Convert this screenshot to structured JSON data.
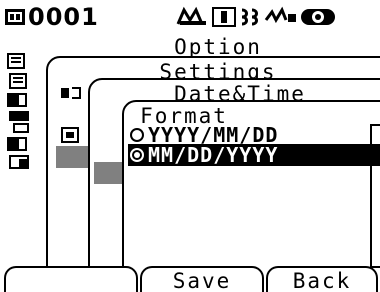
{
  "status": {
    "counter": "0001",
    "icons": [
      "memory-icon",
      "calibration-icon",
      "target-icon",
      "battery-icon",
      "signal-icon",
      "record-icon"
    ]
  },
  "menu": {
    "level1_title": "Option",
    "level2_title": "Settings",
    "level3_title": "Date&Time",
    "level4_title": "Format"
  },
  "format": {
    "options": [
      {
        "label": "YYYY/MM/DD",
        "selected": false
      },
      {
        "label": "MM/DD/YYYY",
        "selected": true
      }
    ]
  },
  "softkeys": {
    "left": "",
    "center": "Save",
    "right": "Back"
  }
}
